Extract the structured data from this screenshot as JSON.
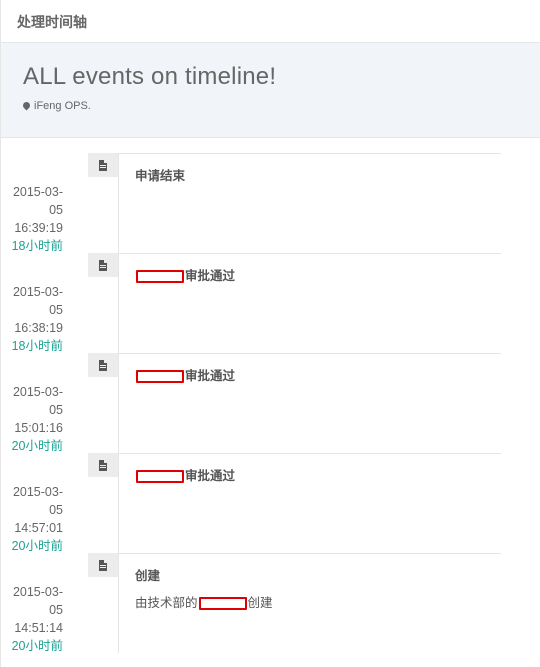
{
  "panel": {
    "title": "处理时间轴"
  },
  "banner": {
    "heading": "ALL events on timeline!",
    "subtitle": "iFeng OPS."
  },
  "colors": {
    "ago_text": "#1aa394",
    "redaction_box": "#e00000",
    "banner_bg": "#f1f4f8"
  },
  "events": [
    {
      "icon": "file-icon",
      "date": "2015-03-05",
      "time": "16:39:19",
      "ago": "18小时前",
      "title_prefix": "",
      "title_redacted": false,
      "title_suffix": "申请结束",
      "desc": ""
    },
    {
      "icon": "file-icon",
      "date": "2015-03-05",
      "time": "16:38:19",
      "ago": "18小时前",
      "title_prefix": "",
      "title_redacted": true,
      "title_suffix": "审批通过",
      "desc": ""
    },
    {
      "icon": "file-icon",
      "date": "2015-03-05",
      "time": "15:01:16",
      "ago": "20小时前",
      "title_prefix": "",
      "title_redacted": true,
      "title_suffix": "审批通过",
      "desc": ""
    },
    {
      "icon": "file-icon",
      "date": "2015-03-05",
      "time": "14:57:01",
      "ago": "20小时前",
      "title_prefix": "",
      "title_redacted": true,
      "title_suffix": "审批通过",
      "desc": ""
    },
    {
      "icon": "file-icon",
      "date": "2015-03-05",
      "time": "14:51:14",
      "ago": "20小时前",
      "title_prefix": "",
      "title_redacted": false,
      "title_suffix": "创建",
      "desc_prefix": "由技术部的",
      "desc_suffix": "创建"
    }
  ]
}
